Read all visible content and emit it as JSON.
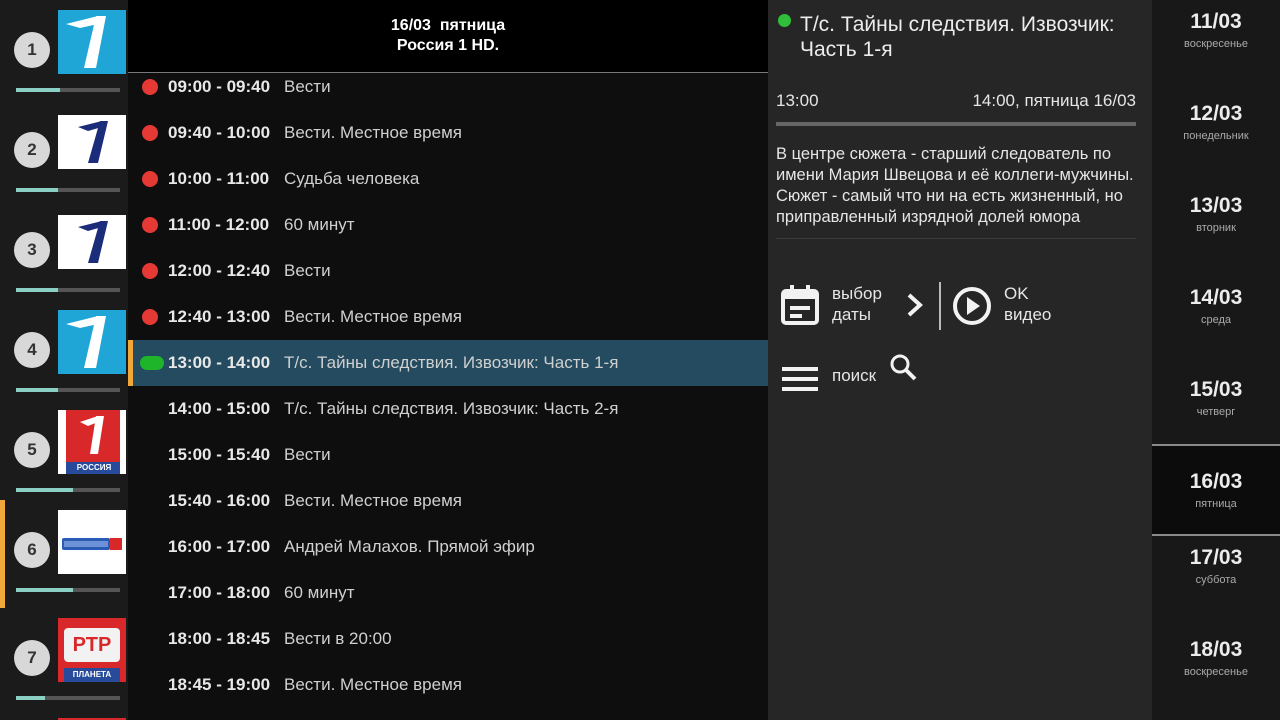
{
  "channels": [
    {
      "num": "1",
      "logo": "perviy-logo-cyan",
      "progress": 0.4
    },
    {
      "num": "2",
      "logo": "perviy-logo-dark",
      "progress": 0.4
    },
    {
      "num": "3",
      "logo": "perviy-logo-dark",
      "progress": 0.4
    },
    {
      "num": "4",
      "logo": "perviy-logo-cyan",
      "progress": 0.4
    },
    {
      "num": "5",
      "logo": "perviy-russia-logo",
      "progress": 0.55,
      "logo_caption": "РОССИЯ"
    },
    {
      "num": "6",
      "logo": "russia1-hd-logo",
      "progress": 0.55
    },
    {
      "num": "7",
      "logo": "rtr-planeta-logo",
      "progress": 0.3,
      "logo_text": "РТР",
      "logo_caption": "ПЛАНЕТА"
    }
  ],
  "schedule": {
    "date_line": "16/03  пятница",
    "channel_line": "Россия 1 HD.",
    "programs": [
      {
        "time": "09:00 - 09:40",
        "title": "Вести",
        "state": "past"
      },
      {
        "time": "09:40 - 10:00",
        "title": "Вести. Местное время",
        "state": "past"
      },
      {
        "time": "10:00 - 11:00",
        "title": "Судьба человека",
        "state": "past"
      },
      {
        "time": "11:00 - 12:00",
        "title": "60 минут",
        "state": "past"
      },
      {
        "time": "12:00 - 12:40",
        "title": "Вести",
        "state": "past"
      },
      {
        "time": "12:40 - 13:00",
        "title": "Вести. Местное время",
        "state": "past"
      },
      {
        "time": "13:00 - 14:00",
        "title": "Т/с. Тайны следствия. Извозчик: Часть 1-я",
        "state": "live"
      },
      {
        "time": "14:00 - 15:00",
        "title": "Т/с. Тайны следствия. Извозчик: Часть 2-я",
        "state": "future"
      },
      {
        "time": "15:00 - 15:40",
        "title": "Вести",
        "state": "future"
      },
      {
        "time": "15:40 - 16:00",
        "title": "Вести. Местное время",
        "state": "future"
      },
      {
        "time": "16:00 - 17:00",
        "title": "Андрей Малахов. Прямой эфир",
        "state": "future"
      },
      {
        "time": "17:00 - 18:00",
        "title": "60 минут",
        "state": "future"
      },
      {
        "time": "18:00 - 18:45",
        "title": "Вести в 20:00",
        "state": "future"
      },
      {
        "time": "18:45 - 19:00",
        "title": "Вести. Местное время",
        "state": "future"
      }
    ]
  },
  "details": {
    "title": "Т/с. Тайны следствия. Извозчик: Часть 1-я",
    "start": "13:00",
    "end": "14:00, пятница 16/03",
    "description": "В центре сюжета - старший следователь по имени Мария Швецова и её коллеги-мужчины. Сюжет - самый что ни на есть жизненный, но приправленный изрядной долей юмора",
    "date_button": [
      "выбор",
      "даты"
    ],
    "ok_button": [
      "OK",
      "видео"
    ],
    "search_label": "поиск"
  },
  "dates": [
    {
      "day": "11/03",
      "weekday": "воскресенье"
    },
    {
      "day": "12/03",
      "weekday": "понедельник"
    },
    {
      "day": "13/03",
      "weekday": "вторник"
    },
    {
      "day": "14/03",
      "weekday": "среда"
    },
    {
      "day": "15/03",
      "weekday": "четверг"
    },
    {
      "day": "16/03",
      "weekday": "пятница",
      "selected": true
    },
    {
      "day": "17/03",
      "weekday": "суббота"
    },
    {
      "day": "18/03",
      "weekday": "воскресенье"
    }
  ],
  "colors": {
    "accent": "#f0a83a",
    "live": "#1fb52b",
    "past": "#e53935",
    "selected_row": "#244b5f"
  }
}
